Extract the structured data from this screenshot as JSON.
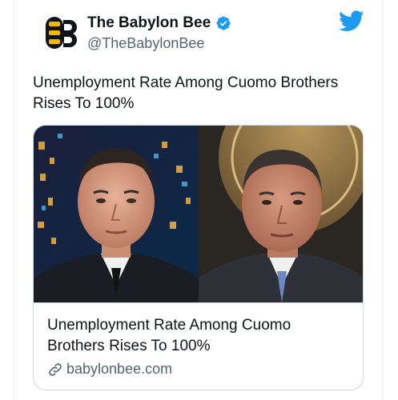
{
  "author": {
    "display_name": "The Babylon Bee",
    "handle": "@TheBabylonBee",
    "verified": true,
    "avatar_icon": "bee-logo-icon"
  },
  "platform_icon": "twitter-bird-icon",
  "tweet": {
    "text": "Unemployment Rate Among Cuomo Brothers Rises To 100%"
  },
  "card": {
    "image_description_icon": "two-portraits-image",
    "title": "Unemployment Rate Among Cuomo Brothers Rises To 100%",
    "domain": "babylonbee.com",
    "link_icon": "link-icon"
  },
  "colors": {
    "twitter_blue": "#1d9bf0",
    "text_primary": "#0f1419",
    "text_secondary": "#536471",
    "border": "#cfd9de"
  }
}
